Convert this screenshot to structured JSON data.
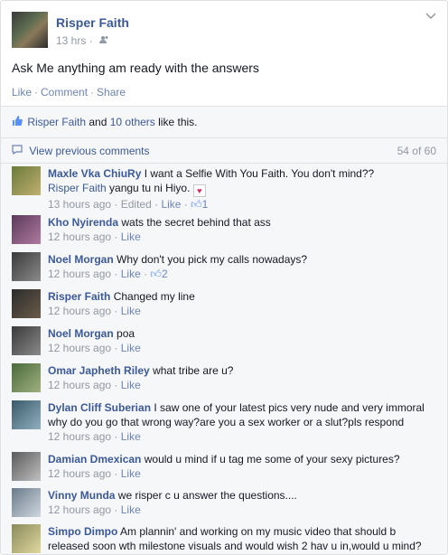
{
  "post": {
    "author": "Risper Faith",
    "time": "13 hrs",
    "audience_icon": "friends-icon",
    "status": "Ask Me anything am ready with the answers",
    "actions": {
      "like": "Like",
      "comment": "Comment",
      "share": "Share"
    }
  },
  "likes": {
    "name": "Risper Faith",
    "and": "and",
    "others": "10 others",
    "tail": "like this."
  },
  "comments_header": {
    "view_previous": "View previous comments",
    "count": "54 of 60"
  },
  "comments": [
    {
      "name": "Maxle Vka ChiuRy",
      "text": "I want a Selfie With You Faith. You don't mind??",
      "meta": "13 hours ago",
      "edited": "Edited",
      "like": "Like",
      "likes": "1",
      "reply": {
        "name": "Risper Faith",
        "text": "yangu tu ni Hiyo."
      }
    },
    {
      "name": "Kho Nyirenda",
      "text": "wats the secret behind that ass",
      "meta": "12 hours ago",
      "like": "Like"
    },
    {
      "name": "Noel Morgan",
      "text": "Why don't you pick my calls nowadays?",
      "meta": "12 hours ago",
      "like": "Like",
      "likes": "2"
    },
    {
      "name": "Risper Faith",
      "text": "Changed my line",
      "meta": "12 hours ago",
      "like": "Like"
    },
    {
      "name": "Noel Morgan",
      "text": "poa",
      "meta": "12 hours ago",
      "like": "Like"
    },
    {
      "name": "Omar Japheth Riley",
      "text": "what tribe are u?",
      "meta": "12 hours ago",
      "like": "Like"
    },
    {
      "name": "Dylan Cliff Suberian",
      "text": "I saw one of your latest pics very nude and very immoral why do you go that wrong way?are you a sex worker or a slut?pls respond",
      "meta": "12 hours ago",
      "like": "Like"
    },
    {
      "name": "Damian Dmexican",
      "text": "would u mind if u tag me some of your sexy pictures?",
      "meta": "12 hours ago",
      "like": "Like"
    },
    {
      "name": "Vinny Munda",
      "text": "we risper c u answer the questions....",
      "meta": "12 hours ago",
      "like": "Like"
    },
    {
      "name": "Simpo Dimpo",
      "text": "Am plannin' and working on my music video that should b released soon wth milestone visuals and would wish 2 hav u in,would u mind?",
      "meta": "",
      "like": ""
    }
  ],
  "colors": {
    "link": "#3b5998",
    "meta": "#9197a3",
    "bg": "#f6f7f9"
  }
}
